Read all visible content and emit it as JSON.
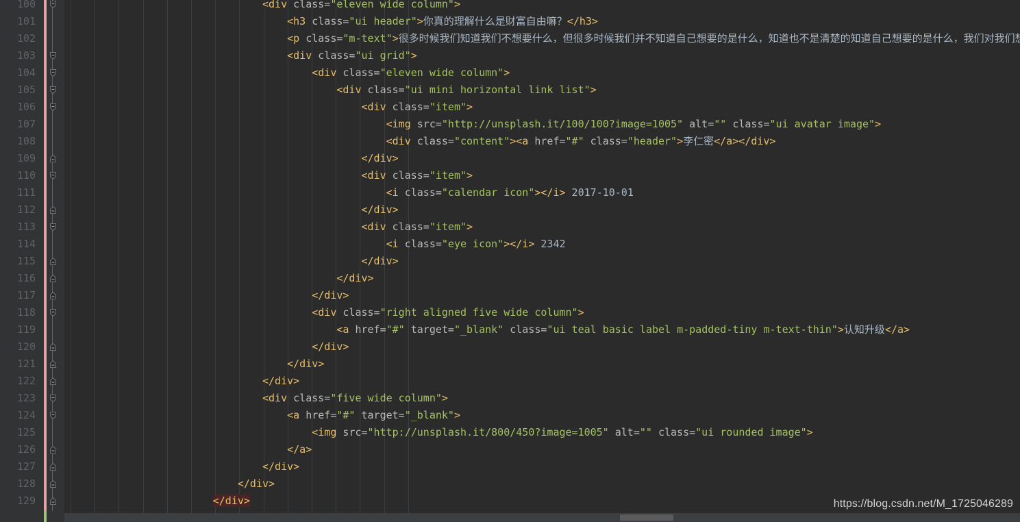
{
  "editor": {
    "theme": "darcula",
    "language": "HTML",
    "background": "#2b2b2b",
    "gutter_background": "#313335",
    "first_line": 100,
    "last_line": 129,
    "colors": {
      "tag": "#e8bf6a",
      "attribute_name": "#bababa",
      "attribute_value": "#a5c261",
      "text": "#a9b7c6",
      "line_number": "#606366",
      "error_highlight": "#4b2526",
      "vcs_modified": "#e6a2a2",
      "vcs_added": "#9ec37a",
      "indent_guide": "#3b3e40",
      "scrollbar_thumb": "#595b5d"
    }
  },
  "watermark": {
    "text": "https://blog.csdn.net/M_1725046289"
  },
  "lines": [
    {
      "number": "100",
      "indent": 8,
      "fold": "start",
      "tokens": [
        {
          "t": "tag",
          "s": "<div "
        },
        {
          "t": "attr",
          "s": "class="
        },
        {
          "t": "val",
          "s": "\"eleven wide column\""
        },
        {
          "t": "tag",
          "s": ">"
        }
      ]
    },
    {
      "number": "101",
      "indent": 9,
      "fold": "none",
      "tokens": [
        {
          "t": "tag",
          "s": "<h3 "
        },
        {
          "t": "attr",
          "s": "class="
        },
        {
          "t": "val",
          "s": "\"ui header\""
        },
        {
          "t": "tag",
          "s": ">"
        },
        {
          "t": "cjk",
          "s": "你真的理解什么是财富自由嘛？"
        },
        {
          "t": "tag",
          "s": "</h3>"
        }
      ]
    },
    {
      "number": "102",
      "indent": 9,
      "fold": "none",
      "tokens": [
        {
          "t": "tag",
          "s": "<p "
        },
        {
          "t": "attr",
          "s": "class="
        },
        {
          "t": "val",
          "s": "\"m-text\""
        },
        {
          "t": "tag",
          "s": ">"
        },
        {
          "t": "cjk",
          "s": "很多时候我们知道我们不想要什么，但很多时候我们并不知道自己想要的是什么，知道也不是清楚的知道自己想要的是什么，我们对我们想要"
        }
      ]
    },
    {
      "number": "103",
      "indent": 9,
      "fold": "start",
      "tokens": [
        {
          "t": "tag",
          "s": "<div "
        },
        {
          "t": "attr",
          "s": "class="
        },
        {
          "t": "val",
          "s": "\"ui grid\""
        },
        {
          "t": "tag",
          "s": ">"
        }
      ]
    },
    {
      "number": "104",
      "indent": 10,
      "fold": "start",
      "tokens": [
        {
          "t": "tag",
          "s": "<div "
        },
        {
          "t": "attr",
          "s": "class="
        },
        {
          "t": "val",
          "s": "\"eleven wide column\""
        },
        {
          "t": "tag",
          "s": ">"
        }
      ]
    },
    {
      "number": "105",
      "indent": 11,
      "fold": "start",
      "tokens": [
        {
          "t": "tag",
          "s": "<div "
        },
        {
          "t": "attr",
          "s": "class="
        },
        {
          "t": "val",
          "s": "\"ui mini horizontal link list\""
        },
        {
          "t": "tag",
          "s": ">"
        }
      ]
    },
    {
      "number": "106",
      "indent": 12,
      "fold": "start",
      "tokens": [
        {
          "t": "tag",
          "s": "<div "
        },
        {
          "t": "attr",
          "s": "class="
        },
        {
          "t": "val",
          "s": "\"item\""
        },
        {
          "t": "tag",
          "s": ">"
        }
      ]
    },
    {
      "number": "107",
      "indent": 13,
      "fold": "none",
      "tokens": [
        {
          "t": "tag",
          "s": "<img "
        },
        {
          "t": "attr",
          "s": "src="
        },
        {
          "t": "val",
          "s": "\"http://unsplash.it/100/100?image=1005\""
        },
        {
          "t": "attr",
          "s": " alt="
        },
        {
          "t": "val",
          "s": "\"\""
        },
        {
          "t": "attr",
          "s": " class="
        },
        {
          "t": "val",
          "s": "\"ui avatar image\""
        },
        {
          "t": "tag",
          "s": ">"
        }
      ]
    },
    {
      "number": "108",
      "indent": 13,
      "fold": "none",
      "tokens": [
        {
          "t": "tag",
          "s": "<div "
        },
        {
          "t": "attr",
          "s": "class="
        },
        {
          "t": "val",
          "s": "\"content\""
        },
        {
          "t": "tag",
          "s": "><a "
        },
        {
          "t": "attr",
          "s": "href="
        },
        {
          "t": "val",
          "s": "\"#\""
        },
        {
          "t": "attr",
          "s": " class="
        },
        {
          "t": "val",
          "s": "\"header\""
        },
        {
          "t": "tag",
          "s": ">"
        },
        {
          "t": "cjk",
          "s": "李仁密"
        },
        {
          "t": "tag",
          "s": "</a></div>"
        }
      ]
    },
    {
      "number": "109",
      "indent": 12,
      "fold": "end",
      "tokens": [
        {
          "t": "tag",
          "s": "</div>"
        }
      ]
    },
    {
      "number": "110",
      "indent": 12,
      "fold": "start",
      "tokens": [
        {
          "t": "tag",
          "s": "<div "
        },
        {
          "t": "attr",
          "s": "class="
        },
        {
          "t": "val",
          "s": "\"item\""
        },
        {
          "t": "tag",
          "s": ">"
        }
      ]
    },
    {
      "number": "111",
      "indent": 13,
      "fold": "none",
      "tokens": [
        {
          "t": "tag",
          "s": "<i "
        },
        {
          "t": "attr",
          "s": "class="
        },
        {
          "t": "val",
          "s": "\"calendar icon\""
        },
        {
          "t": "tag",
          "s": "></i>"
        },
        {
          "t": "text",
          "s": " 2017-10-01"
        }
      ]
    },
    {
      "number": "112",
      "indent": 12,
      "fold": "end",
      "tokens": [
        {
          "t": "tag",
          "s": "</div>"
        }
      ]
    },
    {
      "number": "113",
      "indent": 12,
      "fold": "start",
      "tokens": [
        {
          "t": "tag",
          "s": "<div "
        },
        {
          "t": "attr",
          "s": "class="
        },
        {
          "t": "val",
          "s": "\"item\""
        },
        {
          "t": "tag",
          "s": ">"
        }
      ]
    },
    {
      "number": "114",
      "indent": 13,
      "fold": "none",
      "tokens": [
        {
          "t": "tag",
          "s": "<i "
        },
        {
          "t": "attr",
          "s": "class="
        },
        {
          "t": "val",
          "s": "\"eye icon\""
        },
        {
          "t": "tag",
          "s": "></i>"
        },
        {
          "t": "text",
          "s": " 2342"
        }
      ]
    },
    {
      "number": "115",
      "indent": 12,
      "fold": "end",
      "tokens": [
        {
          "t": "tag",
          "s": "</div>"
        }
      ]
    },
    {
      "number": "116",
      "indent": 11,
      "fold": "end",
      "tokens": [
        {
          "t": "tag",
          "s": "</div>"
        }
      ]
    },
    {
      "number": "117",
      "indent": 10,
      "fold": "end",
      "tokens": [
        {
          "t": "tag",
          "s": "</div>"
        }
      ]
    },
    {
      "number": "118",
      "indent": 10,
      "fold": "start",
      "tokens": [
        {
          "t": "tag",
          "s": "<div "
        },
        {
          "t": "attr",
          "s": "class="
        },
        {
          "t": "val",
          "s": "\"right aligned five wide column\""
        },
        {
          "t": "tag",
          "s": ">"
        }
      ]
    },
    {
      "number": "119",
      "indent": 11,
      "fold": "none",
      "tokens": [
        {
          "t": "tag",
          "s": "<a "
        },
        {
          "t": "attr",
          "s": "href="
        },
        {
          "t": "val",
          "s": "\"#\""
        },
        {
          "t": "attr",
          "s": " target="
        },
        {
          "t": "val",
          "s": "\"_blank\""
        },
        {
          "t": "attr",
          "s": " class="
        },
        {
          "t": "val",
          "s": "\"ui teal basic label m-padded-tiny m-text-thin\""
        },
        {
          "t": "tag",
          "s": ">"
        },
        {
          "t": "cjk",
          "s": "认知升级"
        },
        {
          "t": "tag",
          "s": "</a>"
        }
      ]
    },
    {
      "number": "120",
      "indent": 10,
      "fold": "end",
      "tokens": [
        {
          "t": "tag",
          "s": "</div>"
        }
      ]
    },
    {
      "number": "121",
      "indent": 9,
      "fold": "end",
      "tokens": [
        {
          "t": "tag",
          "s": "</div>"
        }
      ]
    },
    {
      "number": "122",
      "indent": 8,
      "fold": "end",
      "tokens": [
        {
          "t": "tag",
          "s": "</div>"
        }
      ]
    },
    {
      "number": "123",
      "indent": 8,
      "fold": "start",
      "tokens": [
        {
          "t": "tag",
          "s": "<div "
        },
        {
          "t": "attr",
          "s": "class="
        },
        {
          "t": "val",
          "s": "\"five wide column\""
        },
        {
          "t": "tag",
          "s": ">"
        }
      ]
    },
    {
      "number": "124",
      "indent": 9,
      "fold": "start",
      "tokens": [
        {
          "t": "tag",
          "s": "<a "
        },
        {
          "t": "attr",
          "s": "href="
        },
        {
          "t": "val",
          "s": "\"#\""
        },
        {
          "t": "attr",
          "s": " target="
        },
        {
          "t": "val",
          "s": "\"_blank\""
        },
        {
          "t": "tag",
          "s": ">"
        }
      ]
    },
    {
      "number": "125",
      "indent": 10,
      "fold": "none",
      "tokens": [
        {
          "t": "tag",
          "s": "<img "
        },
        {
          "t": "attr",
          "s": "src="
        },
        {
          "t": "val",
          "s": "\"http://unsplash.it/800/450?image=1005\""
        },
        {
          "t": "attr",
          "s": " alt="
        },
        {
          "t": "val",
          "s": "\"\""
        },
        {
          "t": "attr",
          "s": " class="
        },
        {
          "t": "val",
          "s": "\"ui rounded image\""
        },
        {
          "t": "tag",
          "s": ">"
        }
      ]
    },
    {
      "number": "126",
      "indent": 9,
      "fold": "end",
      "tokens": [
        {
          "t": "tag",
          "s": "</a>"
        }
      ]
    },
    {
      "number": "127",
      "indent": 8,
      "fold": "end",
      "tokens": [
        {
          "t": "tag",
          "s": "</div>"
        }
      ]
    },
    {
      "number": "128",
      "indent": 7,
      "fold": "end",
      "tokens": [
        {
          "t": "tag",
          "s": "</div>"
        }
      ]
    },
    {
      "number": "129",
      "indent": 6,
      "fold": "end",
      "error": true,
      "tokens": [
        {
          "t": "tag",
          "s": "</div>"
        }
      ]
    }
  ]
}
